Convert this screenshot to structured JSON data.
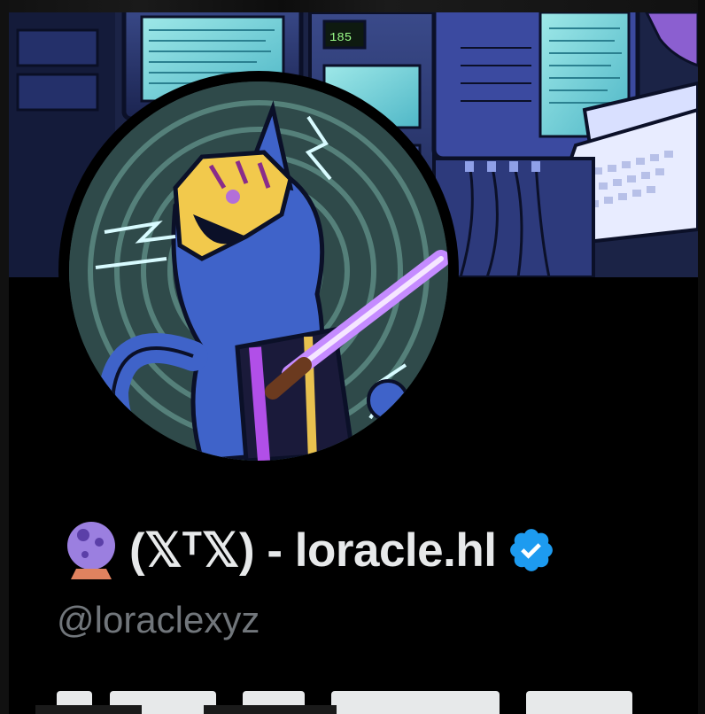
{
  "profile": {
    "display_name": "(𝕏ᵀ𝕏) - loracle.hl",
    "handle": "@loraclexyz",
    "name_emoji": "crystal-ball-icon",
    "verified": true,
    "verified_icon": "verified-badge-icon"
  },
  "colors": {
    "background": "#000000",
    "name_text": "#e7e9ea",
    "handle_text": "#71767b",
    "verified_blue": "#1d9bf0",
    "orb_purple": "#9b7fe0"
  },
  "icons": {
    "banner": "banner-computer-lab-image",
    "avatar": "avatar-cat-with-tiger-mask-image"
  }
}
